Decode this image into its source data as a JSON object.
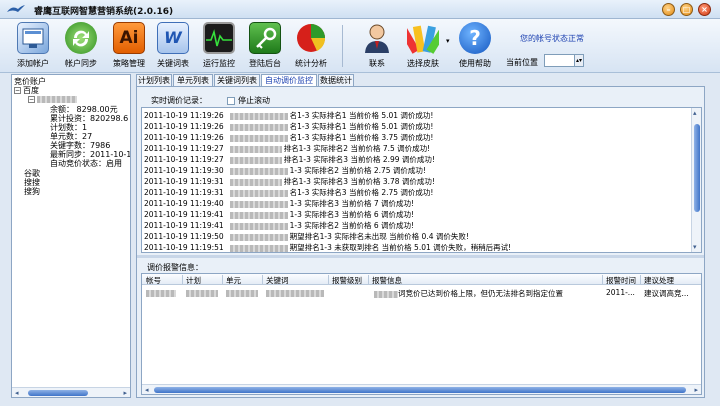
{
  "window": {
    "title": "睿鹰互联网智慧营销系统(2.0.16)"
  },
  "toolbar": {
    "buttons": [
      {
        "label": "添加帐户",
        "icon": "add-account-icon"
      },
      {
        "label": "帐户同步",
        "icon": "sync-icon"
      },
      {
        "label": "策略管理",
        "icon": "strategy-icon"
      },
      {
        "label": "关键词表",
        "icon": "keyword-table-icon"
      },
      {
        "label": "运行监控",
        "icon": "monitor-icon"
      },
      {
        "label": "登陆后台",
        "icon": "login-key-icon"
      },
      {
        "label": "统计分析",
        "icon": "pie-chart-icon"
      },
      {
        "label": "联系",
        "icon": "contact-icon"
      },
      {
        "label": "选择皮肤",
        "icon": "skin-icon"
      },
      {
        "label": "使用帮助",
        "icon": "help-icon"
      }
    ],
    "strategy_glyph": "Ai",
    "keyword_glyph": "W",
    "help_glyph": "?",
    "status_message": "您的帐号状态正常",
    "position_label": "当前位置"
  },
  "sidebar": {
    "root": "竞价账户",
    "engines": [
      "百度",
      "谷歌",
      "搜搜",
      "搜狗"
    ],
    "details": [
      "余额：  8298.00元",
      "累计投资：820298.6",
      "计划数：1",
      "单元数：27",
      "关键字数：7986",
      "最新同步：2011-10-1",
      "自动竞价状态：启用"
    ]
  },
  "tabs": [
    "计划列表",
    "单元列表",
    "关键词列表",
    "自动调价监控",
    "数据统计"
  ],
  "active_tab": 3,
  "realtime": {
    "title": "实时调价记录：",
    "stop_scroll_label": "停止滚动",
    "lines": [
      {
        "time": "2011-10-19 11:19:26",
        "text": "名1-3 实际排名1  当前价格 5.01 调价成功!"
      },
      {
        "time": "2011-10-19 11:19:26",
        "text": "名1-3 实际排名1  当前价格 5.01 调价成功!"
      },
      {
        "time": "2011-10-19 11:19:26",
        "text": "名1-3 实际排名1  当前价格 3.75 调价成功!"
      },
      {
        "time": "2011-10-19 11:19:27",
        "text": "排名1-3 实际排名2  当前价格 7.5 调价成功!"
      },
      {
        "time": "2011-10-19 11:19:27",
        "text": "排名1-3 实际排名3  当前价格 2.99 调价成功!"
      },
      {
        "time": "2011-10-19 11:19:30",
        "text": "1-3 实际排名2  当前价格 2.75 调价成功!"
      },
      {
        "time": "2011-10-19 11:19:31",
        "text": "排名1-3 实际排名3  当前价格 3.78 调价成功!"
      },
      {
        "time": "2011-10-19 11:19:31",
        "text": "名1-3 实际排名3  当前价格 2.75 调价成功!"
      },
      {
        "time": "2011-10-19 11:19:40",
        "text": "1-3 实际排名3  当前价格 7 调价成功!"
      },
      {
        "time": "2011-10-19 11:19:41",
        "text": "1-3 实际排名3  当前价格 6 调价成功!"
      },
      {
        "time": "2011-10-19 11:19:41",
        "text": "1-3 实际排名2  当前价格 6 调价成功!"
      },
      {
        "time": "2011-10-19 11:19:50",
        "text": "期望排名1-3 实际排名未出现  当前价格 0.4 调价失败!"
      },
      {
        "time": "2011-10-19 11:19:51",
        "text": "期望排名1-3 未获取到排名  当前价格 5.01 调价失败，稍稍后再试!"
      }
    ]
  },
  "alerts": {
    "title": "调价报警信息：",
    "columns": [
      "帐号",
      "计划",
      "单元",
      "关键词",
      "报警级别",
      "报警信息",
      "报警时间",
      "建议处理"
    ],
    "rows": [
      {
        "message": "词竞价已达到价格上限，但仍无法排名到指定位置",
        "time": "2011-...",
        "suggestion": "建议调高竞..."
      }
    ]
  }
}
